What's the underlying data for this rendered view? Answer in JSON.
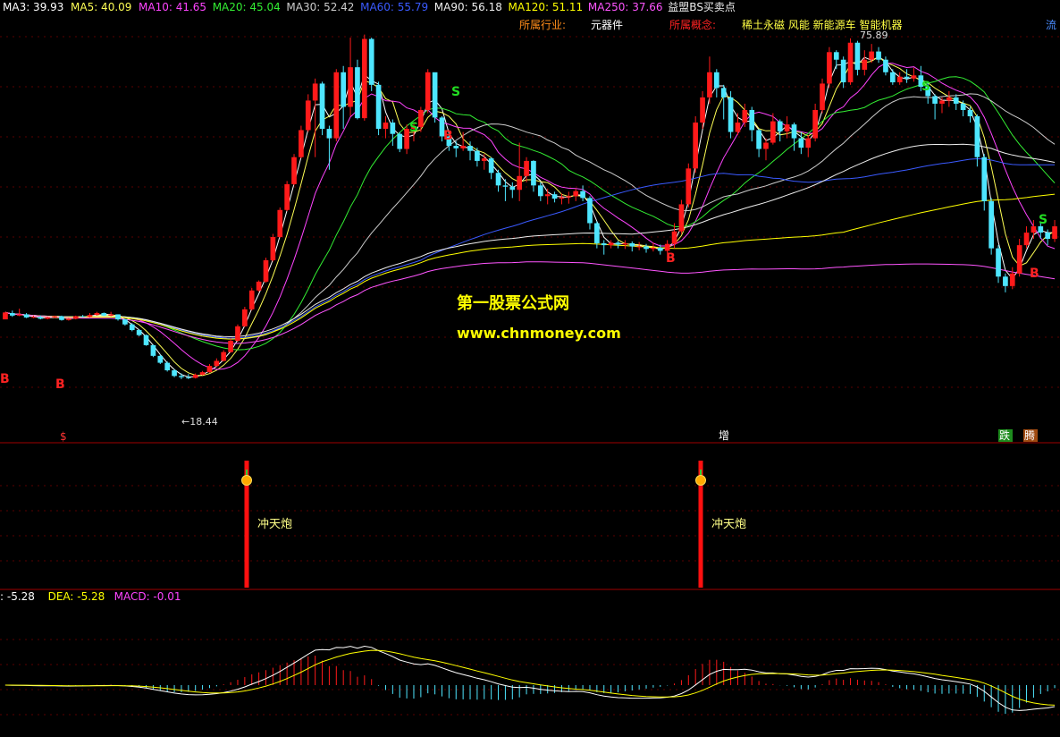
{
  "colors": {
    "bg": "#000000",
    "grid": "#5a0000",
    "divider": "#a00000",
    "up": "#ff1a1a",
    "down": "#4ee6ff",
    "ma3": "#ffffff",
    "ma5": "#ffff55",
    "ma10": "#ff44ff",
    "ma20": "#33ee33",
    "ma30": "#cccccc",
    "ma60": "#3a5aff",
    "ma90": "#eeeeee",
    "ma120": "#ffff00",
    "ma250": "#ff55ff",
    "watermark": "#ffff00"
  },
  "main_header": {
    "items": [
      {
        "label": "MA3: 39.93",
        "color": "#ffffff"
      },
      {
        "label": "MA5: 40.09",
        "color": "#ffff55"
      },
      {
        "label": "MA10: 41.65",
        "color": "#ff44ff"
      },
      {
        "label": "MA20: 45.04",
        "color": "#33ee33"
      },
      {
        "label": "MA30: 52.42",
        "color": "#cccccc"
      },
      {
        "label": "MA60: 55.79",
        "color": "#3a5aff"
      },
      {
        "label": "MA90: 56.18",
        "color": "#eeeeee"
      },
      {
        "label": "MA120: 51.11",
        "color": "#ffff00"
      },
      {
        "label": "MA250: 37.66",
        "color": "#ff55ff"
      },
      {
        "label": "益盟BS买卖点",
        "color": "#eeeeee"
      }
    ]
  },
  "industry": {
    "label": "所属行业:",
    "value": "元器件",
    "concept_label": "所属概念:",
    "concept_value": "稀土永磁 风能 新能源车 智能机器",
    "cut_text": "流"
  },
  "watermark": {
    "line1": "第一股票公式网",
    "line2": "www.chnmoney.com"
  },
  "price_annotations": {
    "high": "75.89",
    "low": "←18.44"
  },
  "bottom_tags": {
    "s_mark": "$",
    "zeng": "增",
    "die": "跌",
    "teng": "腾"
  },
  "signal_panel": {
    "label": "冲天炮",
    "signals": [
      {
        "text": "冲天炮"
      },
      {
        "text": "冲天炮"
      }
    ]
  },
  "macd_header": {
    "items": [
      {
        "label": ": -5.28",
        "color": "#ffffff"
      },
      {
        "label": "DEA: -5.28",
        "color": "#ffff00"
      },
      {
        "label": "MACD: -0.01",
        "color": "#ff44ff"
      }
    ]
  },
  "chart_data": {
    "type": "candlestick",
    "title": "益盟BS买卖点",
    "ylim": [
      14,
      80
    ],
    "candles": [
      [
        31.2,
        32.3,
        31.4,
        32.4
      ],
      [
        32.2,
        31.8,
        31.6,
        32.6
      ],
      [
        31.8,
        32.0,
        31.7,
        32.9
      ],
      [
        32.0,
        31.5,
        31.4,
        32.2
      ],
      [
        31.5,
        31.6,
        31.4,
        31.8
      ],
      [
        31.6,
        31.3,
        31.2,
        31.8
      ],
      [
        31.3,
        31.5,
        31.2,
        31.6
      ],
      [
        31.5,
        31.7,
        31.4,
        31.8
      ],
      [
        31.7,
        31.1,
        31.0,
        31.8
      ],
      [
        31.1,
        31.3,
        31.0,
        31.4
      ],
      [
        31.3,
        31.7,
        31.2,
        31.8
      ],
      [
        31.7,
        31.6,
        31.5,
        31.9
      ],
      [
        31.6,
        31.9,
        31.5,
        32.2
      ],
      [
        31.9,
        32.2,
        31.8,
        32.4
      ],
      [
        32.2,
        31.8,
        31.7,
        32.3
      ],
      [
        31.8,
        32.0,
        31.7,
        32.4
      ],
      [
        32.0,
        31.2,
        31.0,
        32.0
      ],
      [
        31.2,
        30.4,
        30.2,
        31.3
      ],
      [
        30.4,
        29.5,
        29.3,
        30.6
      ],
      [
        29.5,
        28.7,
        28.5,
        29.6
      ],
      [
        28.7,
        27.1,
        27.0,
        28.8
      ],
      [
        27.1,
        25.4,
        25.2,
        27.2
      ],
      [
        25.4,
        24.3,
        24.1,
        25.6
      ],
      [
        24.3,
        23.1,
        22.9,
        24.5
      ],
      [
        23.1,
        22.2,
        22.0,
        23.3
      ],
      [
        22.2,
        22.0,
        21.7,
        22.6
      ],
      [
        22.0,
        21.9,
        21.7,
        22.5
      ],
      [
        21.9,
        22.4,
        21.8,
        22.6
      ],
      [
        22.4,
        22.8,
        22.3,
        23.0
      ],
      [
        22.8,
        23.8,
        22.7,
        24.1
      ],
      [
        23.8,
        24.6,
        23.6,
        25.0
      ],
      [
        24.6,
        26.0,
        24.5,
        26.3
      ],
      [
        26.0,
        27.8,
        25.9,
        28.2
      ],
      [
        27.8,
        30.1,
        27.6,
        30.4
      ],
      [
        30.1,
        32.8,
        30.0,
        33.2
      ],
      [
        32.8,
        35.8,
        32.6,
        36.2
      ],
      [
        35.8,
        37.2,
        35.6,
        37.4
      ],
      [
        37.2,
        40.6,
        37.0,
        41.0
      ],
      [
        40.6,
        44.3,
        40.4,
        44.8
      ],
      [
        44.3,
        48.6,
        44.1,
        49.0
      ],
      [
        48.6,
        52.7,
        48.4,
        53.2
      ],
      [
        52.7,
        57.0,
        52.5,
        57.5
      ],
      [
        57.0,
        61.3,
        56.8,
        62.0
      ],
      [
        61.3,
        66.0,
        61.0,
        67.0
      ],
      [
        66.0,
        68.7,
        57.0,
        69.5
      ],
      [
        68.7,
        61.5,
        60.5,
        69.0
      ],
      [
        61.5,
        60.0,
        55.0,
        62.0
      ],
      [
        60.0,
        70.5,
        59.5,
        71.0
      ],
      [
        70.5,
        65.0,
        61.5,
        71.5
      ],
      [
        65.0,
        71.3,
        63.5,
        76.0
      ],
      [
        71.3,
        63.2,
        63.0,
        72.5
      ],
      [
        63.2,
        75.8,
        62.8,
        76.5
      ],
      [
        75.8,
        68.5,
        67.5,
        76.0
      ],
      [
        68.5,
        61.5,
        60.5,
        69.0
      ],
      [
        61.5,
        62.5,
        60.0,
        63.5
      ],
      [
        62.5,
        60.7,
        58.8,
        63.0
      ],
      [
        60.7,
        58.3,
        57.8,
        61.0
      ],
      [
        58.3,
        61.5,
        57.5,
        62.2
      ],
      [
        61.5,
        61.8,
        59.5,
        62.5
      ],
      [
        61.8,
        64.5,
        61.0,
        65.0
      ],
      [
        64.5,
        70.5,
        64.0,
        71.0
      ],
      [
        70.5,
        63.3,
        62.5,
        66.0
      ],
      [
        63.3,
        60.3,
        59.5,
        63.5
      ],
      [
        60.3,
        58.8,
        58.0,
        61.0
      ],
      [
        58.8,
        58.4,
        57.0,
        59.5
      ],
      [
        58.4,
        58.8,
        58.0,
        61.0
      ],
      [
        58.8,
        58.0,
        56.5,
        59.5
      ],
      [
        58.0,
        56.4,
        55.5,
        58.5
      ],
      [
        56.4,
        56.8,
        55.0,
        57.5
      ],
      [
        56.8,
        54.5,
        53.5,
        57.0
      ],
      [
        54.5,
        52.5,
        51.5,
        55.0
      ],
      [
        52.5,
        52.3,
        50.0,
        53.5
      ],
      [
        52.3,
        51.8,
        50.5,
        53.0
      ],
      [
        51.8,
        54.0,
        50.0,
        59.3
      ],
      [
        54.0,
        56.4,
        53.0,
        57.0
      ],
      [
        56.4,
        52.5,
        51.5,
        56.5
      ],
      [
        52.5,
        50.8,
        50.0,
        53.0
      ],
      [
        50.8,
        51.1,
        49.5,
        52.0
      ],
      [
        51.1,
        50.4,
        49.8,
        51.5
      ],
      [
        50.4,
        50.6,
        49.5,
        51.2
      ],
      [
        50.6,
        50.8,
        49.6,
        51.5
      ],
      [
        50.8,
        51.6,
        50.0,
        52.0
      ],
      [
        51.6,
        50.5,
        50.0,
        52.5
      ],
      [
        50.5,
        46.5,
        45.5,
        50.8
      ],
      [
        46.5,
        43.3,
        42.5,
        46.8
      ],
      [
        43.3,
        43.0,
        41.5,
        43.8
      ],
      [
        43.0,
        43.4,
        42.5,
        43.8
      ],
      [
        43.4,
        43.1,
        42.5,
        43.7
      ],
      [
        43.1,
        43.3,
        42.4,
        43.8
      ],
      [
        43.3,
        42.8,
        42.0,
        43.6
      ],
      [
        42.8,
        42.8,
        42.2,
        43.5
      ],
      [
        42.8,
        42.4,
        41.8,
        43.2
      ],
      [
        42.4,
        42.6,
        42.0,
        43.4
      ],
      [
        42.6,
        42.1,
        41.5,
        43.1
      ],
      [
        42.1,
        43.2,
        41.8,
        43.8
      ],
      [
        43.2,
        45.2,
        42.5,
        46.5
      ],
      [
        45.2,
        49.5,
        44.8,
        50.2
      ],
      [
        49.5,
        55.2,
        49.0,
        56.0
      ],
      [
        55.2,
        62.5,
        54.5,
        63.5
      ],
      [
        62.5,
        66.5,
        61.5,
        67.5
      ],
      [
        66.5,
        70.5,
        65.5,
        73.0
      ],
      [
        70.5,
        68.0,
        66.5,
        71.0
      ],
      [
        68.0,
        66.5,
        63.0,
        68.5
      ],
      [
        66.5,
        61.0,
        60.0,
        67.5
      ],
      [
        61.0,
        62.5,
        60.5,
        64.0
      ],
      [
        62.5,
        64.5,
        61.8,
        65.5
      ],
      [
        64.5,
        61.3,
        59.5,
        65.0
      ],
      [
        61.3,
        58.3,
        57.0,
        61.5
      ],
      [
        58.3,
        59.3,
        56.5,
        60.0
      ],
      [
        59.3,
        62.7,
        59.0,
        64.0
      ],
      [
        62.7,
        61.1,
        59.5,
        63.0
      ],
      [
        61.1,
        62.2,
        60.0,
        63.5
      ],
      [
        62.2,
        60.0,
        58.0,
        62.5
      ],
      [
        60.0,
        58.5,
        57.5,
        61.0
      ],
      [
        58.5,
        60.0,
        57.0,
        60.5
      ],
      [
        60.0,
        64.5,
        59.5,
        65.5
      ],
      [
        64.5,
        68.7,
        64.0,
        69.5
      ],
      [
        68.7,
        73.7,
        68.0,
        74.5
      ],
      [
        73.7,
        72.5,
        71.0,
        74.0
      ],
      [
        72.5,
        68.9,
        68.0,
        73.0
      ],
      [
        68.9,
        75.2,
        68.5,
        75.9
      ],
      [
        75.2,
        70.9,
        70.0,
        75.5
      ],
      [
        70.9,
        72.5,
        70.0,
        74.0
      ],
      [
        72.5,
        73.8,
        72.0,
        75.0
      ],
      [
        73.8,
        72.5,
        72.0,
        74.5
      ],
      [
        72.5,
        70.5,
        70.0,
        73.0
      ],
      [
        70.5,
        68.9,
        68.5,
        71.0
      ],
      [
        68.9,
        69.8,
        68.5,
        70.5
      ],
      [
        69.8,
        69.5,
        68.8,
        71.0
      ],
      [
        69.5,
        70.0,
        69.0,
        71.2
      ],
      [
        70.0,
        68.2,
        67.5,
        71.5
      ],
      [
        68.2,
        66.7,
        65.5,
        69.0
      ],
      [
        66.7,
        65.5,
        63.0,
        67.0
      ],
      [
        65.5,
        66.0,
        64.0,
        66.5
      ],
      [
        66.0,
        66.5,
        65.0,
        67.5
      ],
      [
        66.5,
        65.5,
        64.5,
        67.0
      ],
      [
        65.5,
        64.5,
        63.5,
        66.0
      ],
      [
        64.5,
        63.5,
        62.5,
        65.0
      ],
      [
        63.5,
        57.0,
        55.5,
        63.8
      ],
      [
        57.0,
        50.0,
        48.5,
        57.5
      ],
      [
        50.0,
        42.5,
        41.5,
        50.5
      ],
      [
        42.5,
        38.0,
        37.0,
        43.0
      ],
      [
        38.0,
        36.5,
        35.5,
        38.5
      ],
      [
        36.5,
        38.5,
        36.0,
        39.5
      ],
      [
        38.5,
        43.0,
        38.0,
        44.0
      ],
      [
        43.0,
        45.0,
        42.5,
        46.0
      ],
      [
        45.0,
        46.0,
        44.0,
        47.0
      ],
      [
        46.0,
        45.0,
        44.0,
        46.5
      ],
      [
        45.0,
        44.0,
        43.0,
        45.5
      ],
      [
        44.0,
        46.0,
        43.5,
        47.0
      ]
    ],
    "ma_lines": {
      "MA3": 39.93,
      "MA5": 40.09,
      "MA10": 41.65,
      "MA20": 45.04,
      "MA30": 52.42,
      "MA60": 55.79,
      "MA90": 56.18,
      "MA120": 51.11,
      "MA250": 37.66
    },
    "bs_signals": [
      {
        "type": "B"
      },
      {
        "type": "B"
      },
      {
        "type": "S"
      },
      {
        "type": "S"
      },
      {
        "type": "B"
      },
      {
        "type": "B"
      },
      {
        "type": "S"
      },
      {
        "type": "S"
      },
      {
        "type": "B"
      }
    ],
    "macd": {
      "DIF": -5.28,
      "DEA": -5.28,
      "MACD": -0.01
    }
  }
}
